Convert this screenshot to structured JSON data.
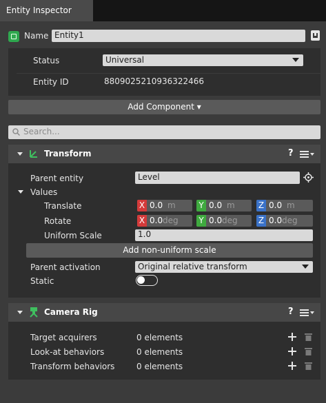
{
  "window": {
    "tab_title": "Entity Inspector"
  },
  "entity": {
    "name_label": "Name",
    "name_value": "Entity1",
    "status_label": "Status",
    "status_value": "Universal",
    "id_label": "Entity ID",
    "id_value": "8809025210936322466",
    "add_component_label": "Add Component ▾"
  },
  "search": {
    "placeholder": "Search..."
  },
  "transform": {
    "title": "Transform",
    "help": "?",
    "parent_entity_label": "Parent entity",
    "parent_entity_value": "Level",
    "values_label": "Values",
    "translate_label": "Translate",
    "translate": {
      "x": "0.0",
      "y": "0.0",
      "z": "0.0",
      "unit": "m"
    },
    "rotate_label": "Rotate",
    "rotate": {
      "x": "0.0",
      "y": "0.0",
      "z": "0.0",
      "unit": "deg"
    },
    "uniform_scale_label": "Uniform Scale",
    "uniform_scale_value": "1.0",
    "add_nonuniform_label": "Add non-uniform scale",
    "parent_activation_label": "Parent activation",
    "parent_activation_value": "Original relative transform",
    "static_label": "Static",
    "static_on": false
  },
  "camera_rig": {
    "title": "Camera Rig",
    "help": "?",
    "rows": [
      {
        "label": "Target acquirers",
        "value": "0 elements"
      },
      {
        "label": "Look-at behaviors",
        "value": "0 elements"
      },
      {
        "label": "Transform behaviors",
        "value": "0 elements"
      }
    ]
  },
  "axis_tags": {
    "x": "X",
    "y": "Y",
    "z": "Z"
  },
  "colors": {
    "x_axis": "#d43b3b",
    "y_axis": "#3faa3f",
    "z_axis": "#3a72c8",
    "entity_icon": "#2fa84f",
    "component_icon": "#3fbf5f"
  }
}
